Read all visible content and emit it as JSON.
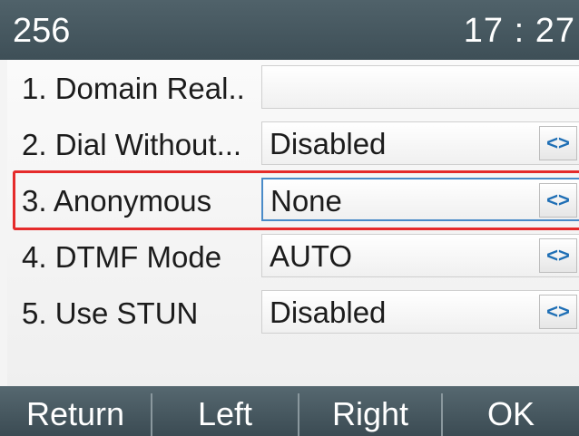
{
  "header": {
    "account": "256",
    "time": "17 : 27"
  },
  "settings": [
    {
      "number_label": "1. Domain Real..",
      "value": "",
      "has_toggle": false
    },
    {
      "number_label": "2. Dial Without...",
      "value": "Disabled",
      "has_toggle": true
    },
    {
      "number_label": "3. Anonymous",
      "value": "None",
      "has_toggle": true,
      "selected": true
    },
    {
      "number_label": "4. DTMF Mode",
      "value": "AUTO",
      "has_toggle": true
    },
    {
      "number_label": "5. Use STUN",
      "value": "Disabled",
      "has_toggle": true
    }
  ],
  "toggle_glyph": "<>",
  "softkeys": {
    "return": "Return",
    "left": "Left",
    "right": "Right",
    "ok": "OK"
  },
  "colors": {
    "header_bg": "#4a5b63",
    "highlight": "#e52b2b",
    "toggle_arrows": "#1f6fb5",
    "selected_field_border": "#4a8bc8"
  }
}
